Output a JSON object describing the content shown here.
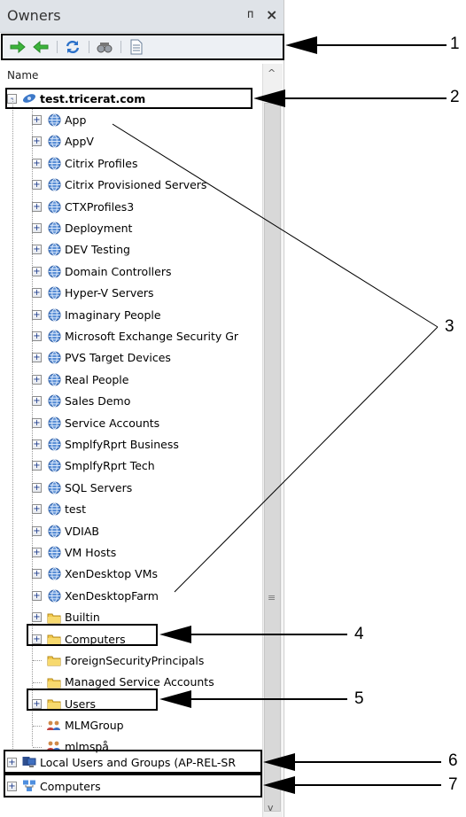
{
  "panel": {
    "title": "Owners",
    "pin_glyph": "ᴨ",
    "close_glyph": "×",
    "column_header": "Name"
  },
  "toolbar": {
    "items": [
      "forward-arrow-icon",
      "back-arrow-icon",
      "refresh-icon",
      "binoculars-icon",
      "document-icon"
    ]
  },
  "tree": {
    "domain": "test.tricerat.com",
    "ous": [
      "App",
      "AppV",
      "Citrix Profiles",
      "Citrix Provisioned Servers",
      "CTXProfiles3",
      "Deployment",
      "DEV Testing",
      "Domain Controllers",
      "Hyper-V Servers",
      "Imaginary People",
      "Microsoft Exchange Security Gr",
      "PVS Target Devices",
      "Real People",
      "Sales Demo",
      "Service Accounts",
      "SmplfyRprt Business",
      "SmplfyRprt Tech",
      "SQL Servers",
      "test",
      "VDIAB",
      "VM Hosts",
      "XenDesktop VMs",
      "XenDesktopFarm"
    ],
    "containers": [
      {
        "label": "Builtin",
        "expandable": true
      },
      {
        "label": "Computers",
        "expandable": true
      },
      {
        "label": "ForeignSecurityPrincipals",
        "expandable": false
      },
      {
        "label": "Managed Service Accounts",
        "expandable": false
      },
      {
        "label": "Users",
        "expandable": true
      }
    ],
    "groups": [
      "MLMGroup",
      "mlmspå"
    ],
    "local": "Local Users and Groups (AP-REL-SR",
    "computers": "Computers"
  },
  "callouts": [
    "1",
    "2",
    "3",
    "4",
    "5",
    "6",
    "7"
  ],
  "colors": {
    "annotation": "#000000",
    "ou_globe": "#3c78c8",
    "folder": "#f2c94c",
    "arrow_green": "#3cb43c"
  }
}
